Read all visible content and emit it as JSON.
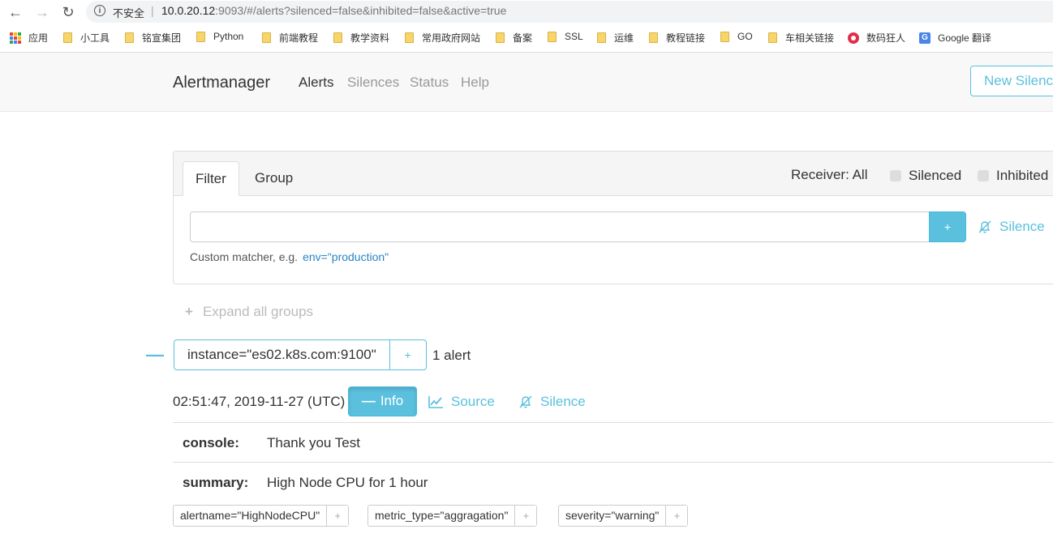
{
  "browser": {
    "back_icon": "arrow-left-icon",
    "forward_icon": "arrow-right-icon",
    "reload_icon": "reload-icon",
    "security_label": "不安全",
    "url_host": "10.0.20.12",
    "url_rest": ":9093/#/alerts?silenced=false&inhibited=false&active=true",
    "bookmarks": [
      "应用",
      "小工具",
      "铭宣集团",
      "Python",
      "前端教程",
      "教学资料",
      "常用政府网站",
      "备案",
      "SSL",
      "运维",
      "教程链接",
      "GO",
      "车相关链接",
      "数码狂人",
      "Google 翻译"
    ]
  },
  "navbar": {
    "brand": "Alertmanager",
    "links": [
      "Alerts",
      "Silences",
      "Status",
      "Help"
    ],
    "new_silence": "New Silence"
  },
  "filter": {
    "tabs": [
      "Filter",
      "Group"
    ],
    "receiver": "Receiver: All",
    "silenced": "Silenced",
    "inhibited": "Inhibited",
    "input_value": "",
    "add_label": "+",
    "silence_label": "Silence",
    "hint": "Custom matcher, e.g.",
    "hint_example": "env=\"production\""
  },
  "expand_all": "Expand all groups",
  "group": {
    "label": "instance=\"es02.k8s.com:9100\"",
    "add_label": "+",
    "count": "1 alert"
  },
  "alert": {
    "timestamp": "02:51:47, 2019-11-27 (UTC)",
    "info_label": "Info",
    "source_label": "Source",
    "silence_label": "Silence",
    "annotations": [
      {
        "key": "console:",
        "value": "Thank you Test"
      },
      {
        "key": "summary:",
        "value": "High Node CPU for 1 hour"
      }
    ],
    "labels": [
      "alertname=\"HighNodeCPU\"",
      "metric_type=\"aggragation\"",
      "severity=\"warning\""
    ],
    "label_add": "+"
  },
  "colors": {
    "accent": "#5bc0de",
    "link_blue": "#2a84c4"
  }
}
